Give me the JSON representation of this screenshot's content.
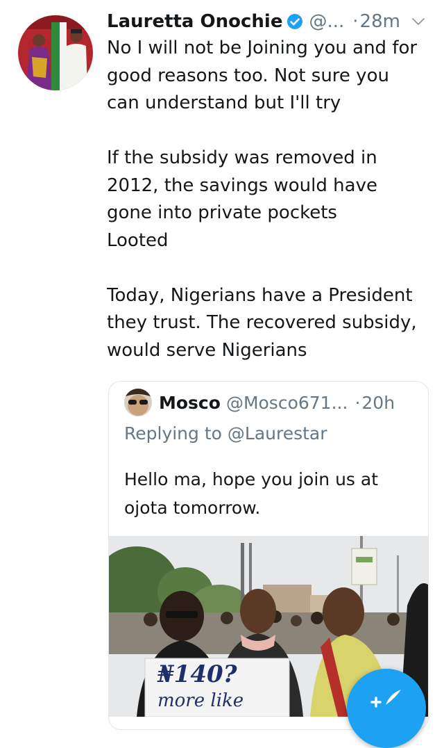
{
  "tweet": {
    "author_name": "Lauretta Onochie",
    "handle": "@...",
    "separator": "·",
    "time": "28m",
    "verified": true,
    "paragraphs": [
      [
        "No I will not be Joining you and for",
        "good reasons too. Not sure you",
        "can understand but I'll try"
      ],
      [
        "If the subsidy was removed in",
        "2012, the savings would have",
        "gone into private pockets",
        "Looted"
      ],
      [
        "Today, Nigerians have a President",
        "they trust. The recovered subsidy,",
        "would serve Nigerians"
      ]
    ]
  },
  "quoted_tweet": {
    "author_name": "Mosco",
    "handle": "@Mosco671...",
    "separator": "·",
    "time": "20h",
    "replying_to": "Replying to @Laurestar",
    "text_lines": [
      "Hello ma, hope you join us at",
      "ojota tomorrow."
    ],
    "media": {
      "sign_text": [
        "₦140?",
        "more like"
      ]
    }
  },
  "colors": {
    "accent": "#1da1f2",
    "text_primary": "#14171a",
    "text_secondary": "#657786",
    "border": "#e1e8ed"
  },
  "icons": {
    "verified": "verified-badge-icon",
    "more": "chevron-down-icon",
    "compose": "compose-tweet-icon"
  }
}
